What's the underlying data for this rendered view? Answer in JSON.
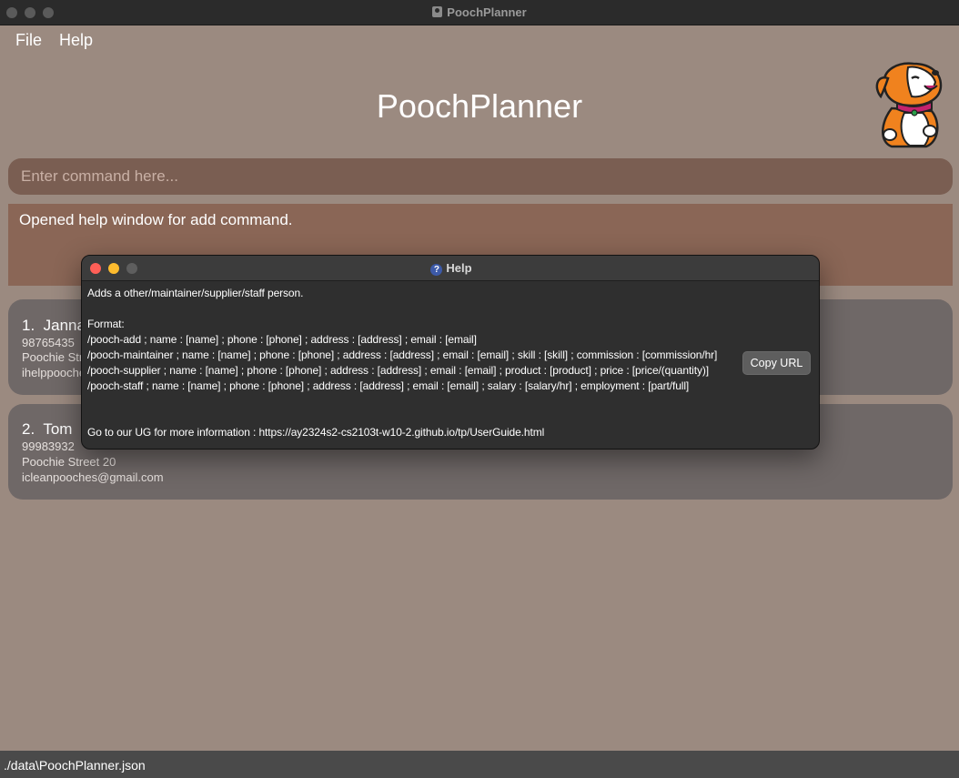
{
  "window": {
    "title": "PoochPlanner"
  },
  "menu": {
    "file": "File",
    "help": "Help"
  },
  "app": {
    "heading": "PoochPlanner"
  },
  "command": {
    "placeholder": "Enter command here..."
  },
  "result": {
    "text": "Opened help window for add command."
  },
  "persons": [
    {
      "index": "1.",
      "name": "Janna",
      "phone": "98765435",
      "address": "Poochie Stre",
      "email": "ihelppooche"
    },
    {
      "index": "2.",
      "name": "Tom",
      "phone": "99983932",
      "address": "Poochie Street 20",
      "email": "icleanpooches@gmail.com"
    }
  ],
  "status": {
    "path": "./data\\PoochPlanner.json"
  },
  "help_dialog": {
    "title": "Help",
    "description": "Adds a other/maintainer/supplier/staff person.",
    "format_label": "Format:",
    "formats": [
      "/pooch-add ; name : [name] ; phone : [phone] ; address : [address] ; email : [email]",
      "/pooch-maintainer ; name : [name] ; phone : [phone] ; address : [address] ; email : [email] ; skill : [skill] ; commission : [commission/hr]",
      "/pooch-supplier ; name : [name] ; phone : [phone] ; address : [address] ; email : [email] ; product : [product] ; price : [price/(quantity)]",
      "/pooch-staff ; name : [name] ; phone : [phone] ; address : [address] ; email : [email] ; salary : [salary/hr]  ; employment : [part/full]"
    ],
    "more_info": "Go to our UG for more information : https://ay2324s2-cs2103t-w10-2.github.io/tp/UserGuide.html",
    "copy_button": "Copy URL"
  },
  "colors": {
    "background": "#9b8a80",
    "command_box": "#7a5e52",
    "result_box": "#8a6656",
    "card": "#6f6867",
    "status_bar": "#4a4a4a",
    "close": "#ff5f57",
    "minimize": "#febc2e"
  },
  "icons": [
    "document-icon",
    "help-question-icon",
    "dog-mascot-icon"
  ]
}
